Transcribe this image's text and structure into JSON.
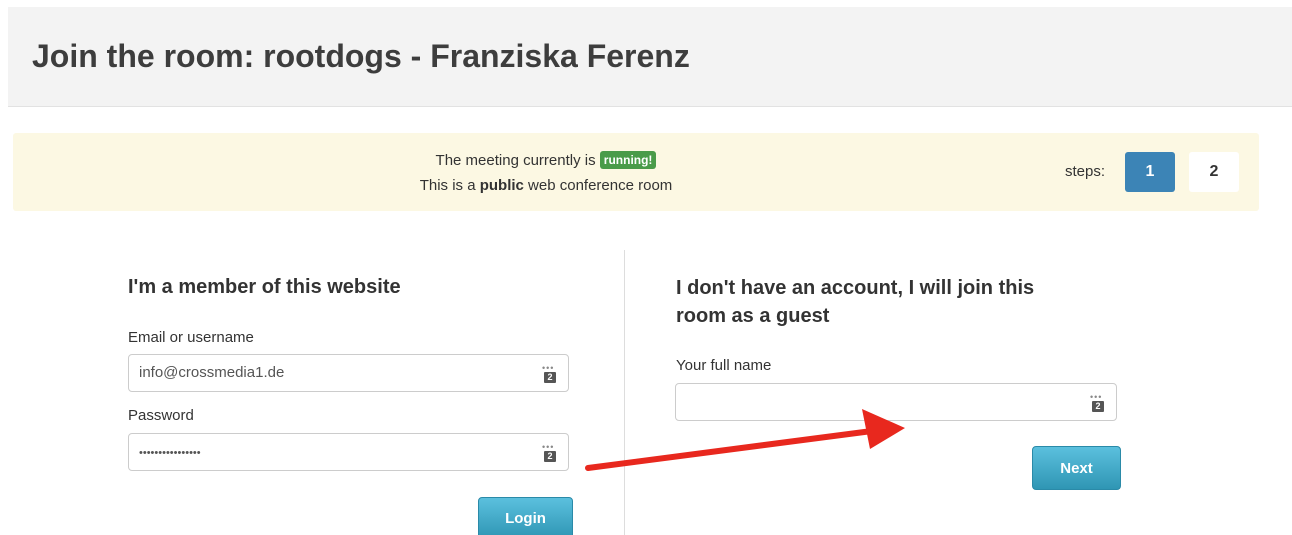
{
  "header": {
    "title": "Join the room: rootdogs - Franziska Ferenz"
  },
  "status": {
    "line1_prefix": "The meeting currently is ",
    "badge": "running!",
    "line2_prefix": "This is a ",
    "line2_bold": "public",
    "line2_suffix": " web conference room",
    "steps_label": "steps:",
    "steps": [
      "1",
      "2"
    ],
    "badge_color": "#4a9b49",
    "active_step_color": "#3c84b6"
  },
  "member": {
    "title": "I'm a member of this website",
    "email_label": "Email or username",
    "email_value": "info@crossmedia1.de",
    "password_label": "Password",
    "password_value": "••••••••••••••••",
    "login_label": "Login"
  },
  "guest": {
    "title_line1": "I don't have an account, I will join this",
    "title_line2": "room as a guest",
    "name_label": "Your full name",
    "name_value": "",
    "next_label": "Next"
  },
  "icons": {
    "field_icon": "password-manager-icon",
    "arrow": "red-arrow-annotation"
  },
  "colors": {
    "button": "#3fa9cc",
    "arrow": "#e8281e",
    "status_bg": "#fcf8e3"
  }
}
